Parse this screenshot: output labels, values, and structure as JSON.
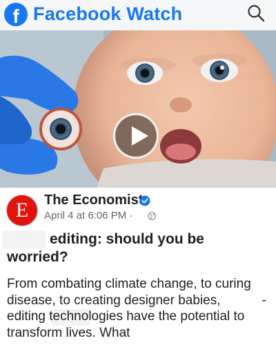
{
  "header": {
    "logo_letter": "f",
    "title": "Facebook Watch",
    "brand_color": "#1877f2"
  },
  "video": {
    "play_icon": "play-icon"
  },
  "post": {
    "avatar_letter": "E",
    "avatar_color": "#e3120b",
    "page_name": "The Economist",
    "timestamp": "April 4 at 6:06 PM",
    "separator": "·",
    "title_line1": "editing: should you be",
    "title_line2": "worried?",
    "body_part1": "From combating climate change, to curing disease, to creating designer babies,",
    "body_part2": "-editing technologies have the potential to transform lives. What"
  }
}
